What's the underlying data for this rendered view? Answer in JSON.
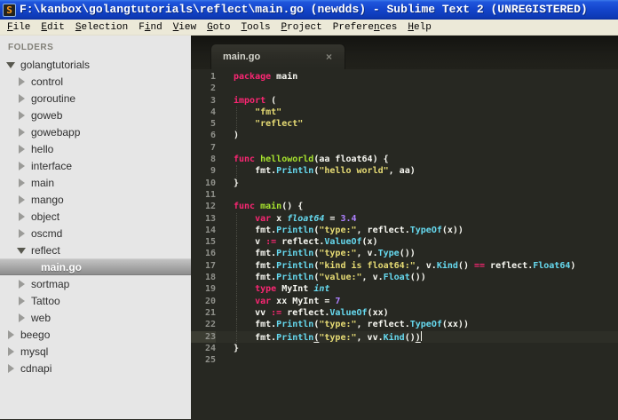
{
  "window": {
    "title": "F:\\kanbox\\golangtutorials\\reflect\\main.go (newdds) - Sublime Text 2 (UNREGISTERED)",
    "app_icon_letter": "S"
  },
  "menu": {
    "items": [
      {
        "label": "File",
        "accel": 0
      },
      {
        "label": "Edit",
        "accel": 0
      },
      {
        "label": "Selection",
        "accel": 0
      },
      {
        "label": "Find",
        "accel": 1
      },
      {
        "label": "View",
        "accel": 0
      },
      {
        "label": "Goto",
        "accel": 0
      },
      {
        "label": "Tools",
        "accel": 0
      },
      {
        "label": "Project",
        "accel": 0
      },
      {
        "label": "Preferences",
        "accel": 7
      },
      {
        "label": "Help",
        "accel": 0
      }
    ]
  },
  "sidebar": {
    "header": "FOLDERS",
    "tree": [
      {
        "label": "golangtutorials",
        "level": 0,
        "type": "folder",
        "state": "expanded"
      },
      {
        "label": "control",
        "level": 1,
        "type": "folder",
        "state": "collapsed"
      },
      {
        "label": "goroutine",
        "level": 1,
        "type": "folder",
        "state": "collapsed"
      },
      {
        "label": "goweb",
        "level": 1,
        "type": "folder",
        "state": "collapsed"
      },
      {
        "label": "gowebapp",
        "level": 1,
        "type": "folder",
        "state": "collapsed"
      },
      {
        "label": "hello",
        "level": 1,
        "type": "folder",
        "state": "collapsed"
      },
      {
        "label": "interface",
        "level": 1,
        "type": "folder",
        "state": "collapsed"
      },
      {
        "label": "main",
        "level": 1,
        "type": "folder",
        "state": "collapsed"
      },
      {
        "label": "mango",
        "level": 1,
        "type": "folder",
        "state": "collapsed"
      },
      {
        "label": "object",
        "level": 1,
        "type": "folder",
        "state": "collapsed"
      },
      {
        "label": "oscmd",
        "level": 1,
        "type": "folder",
        "state": "collapsed"
      },
      {
        "label": "reflect",
        "level": 1,
        "type": "folder",
        "state": "expanded"
      },
      {
        "label": "main.go",
        "level": 2,
        "type": "file",
        "selected": true
      },
      {
        "label": "sortmap",
        "level": 1,
        "type": "folder",
        "state": "collapsed"
      },
      {
        "label": "Tattoo",
        "level": 1,
        "type": "folder",
        "state": "collapsed"
      },
      {
        "label": "web",
        "level": 1,
        "type": "folder",
        "state": "collapsed"
      },
      {
        "label": "beego",
        "level": 0,
        "type": "folder",
        "state": "collapsed"
      },
      {
        "label": "mysql",
        "level": 0,
        "type": "folder",
        "state": "collapsed"
      },
      {
        "label": "cdnapi",
        "level": 0,
        "type": "folder",
        "state": "collapsed"
      }
    ]
  },
  "tab": {
    "label": "main.go",
    "close_glyph": "×"
  },
  "editor": {
    "language": "Go",
    "lines": [
      {
        "n": 1,
        "tk": [
          [
            "k",
            "package"
          ],
          [
            "p",
            " main"
          ]
        ]
      },
      {
        "n": 2,
        "tk": []
      },
      {
        "n": 3,
        "tk": [
          [
            "k",
            "import"
          ],
          [
            "p",
            " ("
          ]
        ]
      },
      {
        "n": 4,
        "g": true,
        "tk": [
          [
            "p",
            "    "
          ],
          [
            "s",
            "\"fmt\""
          ]
        ]
      },
      {
        "n": 5,
        "g": true,
        "tk": [
          [
            "p",
            "    "
          ],
          [
            "s",
            "\"reflect\""
          ]
        ]
      },
      {
        "n": 6,
        "tk": [
          [
            "p",
            ")"
          ]
        ]
      },
      {
        "n": 7,
        "tk": []
      },
      {
        "n": 8,
        "tk": [
          [
            "k",
            "func"
          ],
          [
            "p",
            " "
          ],
          [
            "f",
            "helloworld"
          ],
          [
            "p",
            "(aa float64) {"
          ]
        ]
      },
      {
        "n": 9,
        "g": true,
        "tk": [
          [
            "p",
            "    fmt."
          ],
          [
            "c",
            "Println"
          ],
          [
            "p",
            "("
          ],
          [
            "s",
            "\"hello world\""
          ],
          [
            "p",
            ", aa)"
          ]
        ]
      },
      {
        "n": 10,
        "tk": [
          [
            "p",
            "}"
          ]
        ]
      },
      {
        "n": 11,
        "tk": []
      },
      {
        "n": 12,
        "tk": [
          [
            "k",
            "func"
          ],
          [
            "p",
            " "
          ],
          [
            "f",
            "main"
          ],
          [
            "p",
            "() {"
          ]
        ]
      },
      {
        "n": 13,
        "g": true,
        "tk": [
          [
            "p",
            "    "
          ],
          [
            "k",
            "var"
          ],
          [
            "p",
            " x "
          ],
          [
            "t",
            "float64"
          ],
          [
            "p",
            " = "
          ],
          [
            "n2",
            "3.4"
          ]
        ]
      },
      {
        "n": 14,
        "g": true,
        "tk": [
          [
            "p",
            "    fmt."
          ],
          [
            "c",
            "Println"
          ],
          [
            "p",
            "("
          ],
          [
            "s",
            "\"type:\""
          ],
          [
            "p",
            ", reflect."
          ],
          [
            "c",
            "TypeOf"
          ],
          [
            "p",
            "(x))"
          ]
        ]
      },
      {
        "n": 15,
        "g": true,
        "tk": [
          [
            "p",
            "    v "
          ],
          [
            "k",
            ":="
          ],
          [
            "p",
            " reflect."
          ],
          [
            "c",
            "ValueOf"
          ],
          [
            "p",
            "(x)"
          ]
        ]
      },
      {
        "n": 16,
        "g": true,
        "tk": [
          [
            "p",
            "    fmt."
          ],
          [
            "c",
            "Println"
          ],
          [
            "p",
            "("
          ],
          [
            "s",
            "\"type:\""
          ],
          [
            "p",
            ", v."
          ],
          [
            "c",
            "Type"
          ],
          [
            "p",
            "())"
          ]
        ]
      },
      {
        "n": 17,
        "g": true,
        "tk": [
          [
            "p",
            "    fmt."
          ],
          [
            "c",
            "Println"
          ],
          [
            "p",
            "("
          ],
          [
            "s",
            "\"kind is float64:\""
          ],
          [
            "p",
            ", v."
          ],
          [
            "c",
            "Kind"
          ],
          [
            "p",
            "() "
          ],
          [
            "k",
            "=="
          ],
          [
            "p",
            " reflect."
          ],
          [
            "c",
            "Float64"
          ],
          [
            "p",
            ")"
          ]
        ]
      },
      {
        "n": 18,
        "g": true,
        "tk": [
          [
            "p",
            "    fmt."
          ],
          [
            "c",
            "Println"
          ],
          [
            "p",
            "("
          ],
          [
            "s",
            "\"value:\""
          ],
          [
            "p",
            ", v."
          ],
          [
            "c",
            "Float"
          ],
          [
            "p",
            "())"
          ]
        ]
      },
      {
        "n": 19,
        "g": true,
        "tk": [
          [
            "p",
            "    "
          ],
          [
            "k",
            "type"
          ],
          [
            "p",
            " MyInt "
          ],
          [
            "t",
            "int"
          ]
        ]
      },
      {
        "n": 20,
        "g": true,
        "tk": [
          [
            "p",
            "    "
          ],
          [
            "k",
            "var"
          ],
          [
            "p",
            " xx MyInt = "
          ],
          [
            "n2",
            "7"
          ]
        ]
      },
      {
        "n": 21,
        "g": true,
        "tk": [
          [
            "p",
            "    vv "
          ],
          [
            "k",
            ":="
          ],
          [
            "p",
            " reflect."
          ],
          [
            "c",
            "ValueOf"
          ],
          [
            "p",
            "(xx)"
          ]
        ]
      },
      {
        "n": 22,
        "g": true,
        "tk": [
          [
            "p",
            "    fmt."
          ],
          [
            "c",
            "Println"
          ],
          [
            "p",
            "("
          ],
          [
            "s",
            "\"type:\""
          ],
          [
            "p",
            ", reflect."
          ],
          [
            "c",
            "TypeOf"
          ],
          [
            "p",
            "(xx))"
          ]
        ]
      },
      {
        "n": 23,
        "g": true,
        "cur": true,
        "caret": true,
        "tk": [
          [
            "p",
            "    fmt."
          ],
          [
            "c",
            "Println"
          ],
          [
            "u",
            "("
          ],
          [
            "s",
            "\"type:\""
          ],
          [
            "p",
            ", vv."
          ],
          [
            "c",
            "Kind"
          ],
          [
            "p",
            "()"
          ],
          [
            "u",
            ")"
          ]
        ]
      },
      {
        "n": 24,
        "tk": [
          [
            "p",
            "}"
          ]
        ]
      },
      {
        "n": 25,
        "tk": []
      }
    ]
  },
  "colors": {
    "titlebar_blue": "#1446cd",
    "menubar_bg": "#ece9d8",
    "sidebar_bg": "#e6e6e6",
    "editor_bg": "#272822",
    "keyword_pink": "#f92672",
    "function_green": "#a6e22e",
    "support_cyan": "#66d9ef",
    "string_yellow": "#e6db74",
    "number_purple": "#ae81ff",
    "plain_text": "#f8f8f2",
    "line_number_gray": "#8f908a"
  }
}
